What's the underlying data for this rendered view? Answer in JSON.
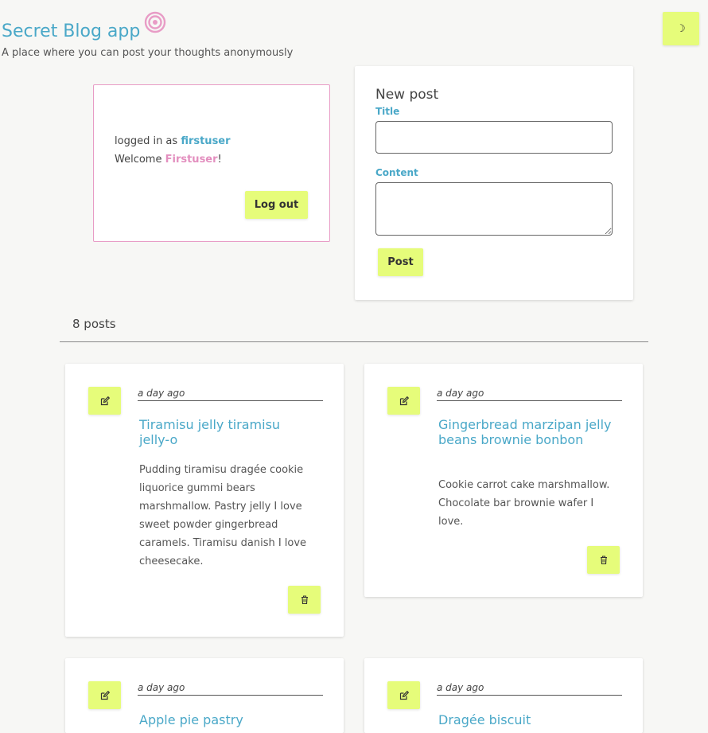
{
  "header": {
    "title": "Secret Blog app",
    "tagline": "A place where you can post your thoughts anonymously",
    "logo_icon": "swirl-icon",
    "theme_toggle_icon": "moon-icon",
    "theme_toggle_label": "☽"
  },
  "user_panel": {
    "logged_in_prefix": "logged in as ",
    "username": "firstuser",
    "welcome_prefix": "Welcome ",
    "display_name": "Firstuser",
    "welcome_suffix": "!",
    "logout_label": "Log out"
  },
  "new_post": {
    "heading": "New post",
    "title_label": "Title",
    "title_value": "",
    "content_label": "Content",
    "content_value": "",
    "submit_label": "Post"
  },
  "posts_count_label": "8 posts",
  "posts": [
    {
      "time": "a day ago",
      "title": "Tiramisu jelly tiramisu jelly-o",
      "content": "Pudding tiramisu dragée cookie liquorice gummi bears marshmallow. Pastry jelly I love sweet powder gingerbread caramels. Tiramisu danish I love cheesecake."
    },
    {
      "time": "a day ago",
      "title": "Gingerbread marzipan jelly beans brownie bonbon",
      "content": "Cookie carrot cake marshmallow. Chocolate bar brownie wafer I love."
    },
    {
      "time": "a day ago",
      "title": "Apple pie pastry",
      "content": ""
    },
    {
      "time": "a day ago",
      "title": "Dragée biscuit",
      "content": ""
    }
  ],
  "colors": {
    "accent_blue": "#4aa8c8",
    "accent_pink": "#e38fbf",
    "button_yellow": "#e6fc7a",
    "background": "#f7f7f5"
  }
}
